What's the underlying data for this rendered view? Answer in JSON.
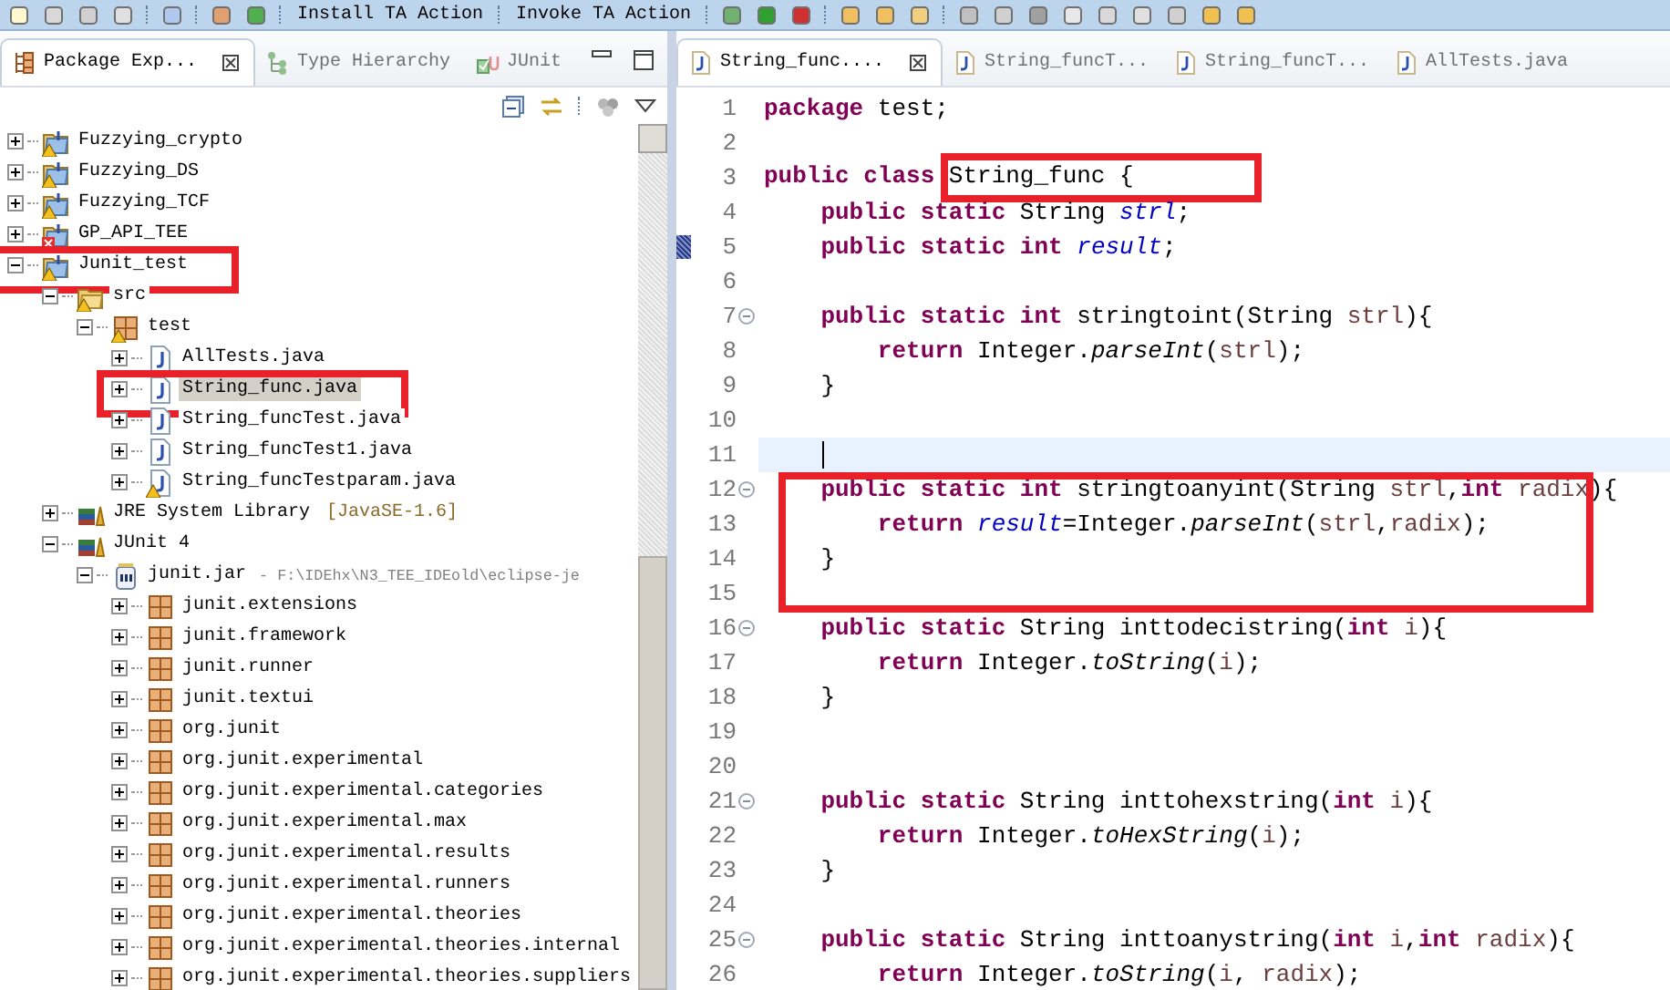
{
  "toolbar": {
    "actions": [
      "Install TA Action",
      "Invoke TA Action"
    ]
  },
  "explorer": {
    "tabs": [
      {
        "label": "Package Exp...",
        "kind": "packages",
        "selected": true,
        "closable": true
      },
      {
        "label": "Type Hierarchy",
        "kind": "hierarchy",
        "selected": false,
        "closable": false
      },
      {
        "label": "JUnit",
        "kind": "junit",
        "selected": false,
        "closable": false
      }
    ],
    "tree": [
      {
        "label": "Fuzzying_crypto",
        "kind": "project",
        "warning": true,
        "error": false,
        "expanded": false,
        "selected": false,
        "annotated": false
      },
      {
        "label": "Fuzzying_DS",
        "kind": "project",
        "warning": true,
        "error": false,
        "expanded": false,
        "selected": false,
        "annotated": false
      },
      {
        "label": "Fuzzying_TCF",
        "kind": "project",
        "warning": true,
        "error": false,
        "expanded": false,
        "selected": false,
        "annotated": false
      },
      {
        "label": "GP_API_TEE",
        "kind": "project",
        "warning": false,
        "error": true,
        "expanded": false,
        "selected": false,
        "annotated": false
      },
      {
        "label": "Junit_test",
        "kind": "project",
        "warning": true,
        "error": false,
        "expanded": true,
        "selected": false,
        "annotated": true,
        "children": [
          {
            "label": "src",
            "kind": "source-folder",
            "warning": true,
            "error": false,
            "expanded": true,
            "selected": false,
            "annotated": false,
            "children": [
              {
                "label": "test",
                "kind": "package",
                "warning": true,
                "error": false,
                "expanded": true,
                "selected": false,
                "annotated": false,
                "children": [
                  {
                    "label": "AllTests.java",
                    "kind": "java",
                    "warning": false,
                    "error": false,
                    "expanded": false,
                    "selected": false,
                    "annotated": false
                  },
                  {
                    "label": "String_func.java",
                    "kind": "java",
                    "warning": false,
                    "error": false,
                    "expanded": false,
                    "selected": true,
                    "annotated": true
                  },
                  {
                    "label": "String_funcTest.java",
                    "kind": "java",
                    "warning": false,
                    "error": false,
                    "expanded": false,
                    "selected": false,
                    "annotated": false
                  },
                  {
                    "label": "String_funcTest1.java",
                    "kind": "java",
                    "warning": false,
                    "error": false,
                    "expanded": false,
                    "selected": false,
                    "annotated": false
                  },
                  {
                    "label": "String_funcTestparam.java",
                    "kind": "java",
                    "warning": true,
                    "error": false,
                    "expanded": false,
                    "selected": false,
                    "annotated": false
                  }
                ]
              }
            ]
          },
          {
            "label": "JRE System Library",
            "detail": "[JavaSE-1.6]",
            "kind": "library",
            "warning": false,
            "error": false,
            "expanded": false,
            "selected": false,
            "annotated": false
          },
          {
            "label": "JUnit 4",
            "kind": "library",
            "warning": false,
            "error": false,
            "expanded": true,
            "selected": false,
            "annotated": false,
            "children": [
              {
                "label": "junit.jar",
                "detail": "- F:\\IDEhx\\N3_TEE_IDEold\\eclipse-je",
                "kind": "jar",
                "warning": false,
                "error": false,
                "expanded": true,
                "selected": false,
                "annotated": false,
                "children": [
                  {
                    "label": "junit.extensions",
                    "kind": "package",
                    "warning": false,
                    "error": false,
                    "expanded": false,
                    "selected": false,
                    "annotated": false
                  },
                  {
                    "label": "junit.framework",
                    "kind": "package",
                    "warning": false,
                    "error": false,
                    "expanded": false,
                    "selected": false,
                    "annotated": false
                  },
                  {
                    "label": "junit.runner",
                    "kind": "package",
                    "warning": false,
                    "error": false,
                    "expanded": false,
                    "selected": false,
                    "annotated": false
                  },
                  {
                    "label": "junit.textui",
                    "kind": "package",
                    "warning": false,
                    "error": false,
                    "expanded": false,
                    "selected": false,
                    "annotated": false
                  },
                  {
                    "label": "org.junit",
                    "kind": "package",
                    "warning": false,
                    "error": false,
                    "expanded": false,
                    "selected": false,
                    "annotated": false
                  },
                  {
                    "label": "org.junit.experimental",
                    "kind": "package",
                    "warning": false,
                    "error": false,
                    "expanded": false,
                    "selected": false,
                    "annotated": false
                  },
                  {
                    "label": "org.junit.experimental.categories",
                    "kind": "package",
                    "warning": false,
                    "error": false,
                    "expanded": false,
                    "selected": false,
                    "annotated": false
                  },
                  {
                    "label": "org.junit.experimental.max",
                    "kind": "package",
                    "warning": false,
                    "error": false,
                    "expanded": false,
                    "selected": false,
                    "annotated": false
                  },
                  {
                    "label": "org.junit.experimental.results",
                    "kind": "package",
                    "warning": false,
                    "error": false,
                    "expanded": false,
                    "selected": false,
                    "annotated": false
                  },
                  {
                    "label": "org.junit.experimental.runners",
                    "kind": "package",
                    "warning": false,
                    "error": false,
                    "expanded": false,
                    "selected": false,
                    "annotated": false
                  },
                  {
                    "label": "org.junit.experimental.theories",
                    "kind": "package",
                    "warning": false,
                    "error": false,
                    "expanded": false,
                    "selected": false,
                    "annotated": false
                  },
                  {
                    "label": "org.junit.experimental.theories.internal",
                    "kind": "package",
                    "warning": false,
                    "error": false,
                    "expanded": false,
                    "selected": false,
                    "annotated": false
                  },
                  {
                    "label": "org.junit.experimental.theories.suppliers",
                    "kind": "package",
                    "warning": false,
                    "error": false,
                    "expanded": false,
                    "selected": false,
                    "annotated": false
                  }
                ]
              }
            ]
          }
        ]
      }
    ]
  },
  "editor": {
    "tabs": [
      {
        "label": "String_func....",
        "selected": true,
        "closable": true
      },
      {
        "label": "String_funcT...",
        "selected": false,
        "closable": false
      },
      {
        "label": "String_funcT...",
        "selected": false,
        "closable": false
      },
      {
        "label": "AllTests.java",
        "selected": false,
        "closable": false
      }
    ],
    "lines": [
      {
        "number": "1",
        "current": false,
        "foldable": false,
        "marker": false,
        "boxed": false,
        "tokens": [
          {
            "kind": "keyword",
            "text": "package"
          },
          {
            "kind": "plain",
            "text": " test;"
          }
        ]
      },
      {
        "number": "2",
        "current": false,
        "foldable": false,
        "marker": false,
        "boxed": false
      },
      {
        "number": "3",
        "current": false,
        "foldable": false,
        "marker": false,
        "boxed": false,
        "tokens": [
          {
            "kind": "keyword",
            "text": "public class "
          },
          {
            "kind": "boxed",
            "text": "String_func {"
          }
        ]
      },
      {
        "number": "4",
        "current": false,
        "foldable": false,
        "marker": false,
        "boxed": false,
        "tokens": [
          {
            "kind": "keyword",
            "text": "    public static"
          },
          {
            "kind": "plain",
            "text": " String "
          },
          {
            "kind": "field",
            "text": "strl"
          },
          {
            "kind": "plain",
            "text": ";"
          }
        ]
      },
      {
        "number": "5",
        "current": false,
        "foldable": false,
        "marker": true,
        "boxed": false,
        "tokens": [
          {
            "kind": "keyword",
            "text": "    public static int "
          },
          {
            "kind": "field",
            "text": "result"
          },
          {
            "kind": "plain",
            "text": ";"
          }
        ]
      },
      {
        "number": "6",
        "current": false,
        "foldable": false,
        "marker": false,
        "boxed": false
      },
      {
        "number": "7",
        "current": false,
        "foldable": true,
        "marker": false,
        "boxed": false,
        "tokens": [
          {
            "kind": "keyword",
            "text": "    public static int"
          },
          {
            "kind": "plain",
            "text": " stringtoint(String "
          },
          {
            "kind": "param",
            "text": "strl"
          },
          {
            "kind": "plain",
            "text": "){"
          }
        ]
      },
      {
        "number": "8",
        "current": false,
        "foldable": false,
        "marker": false,
        "boxed": false,
        "tokens": [
          {
            "kind": "keyword",
            "text": "        return"
          },
          {
            "kind": "plain",
            "text": " Integer."
          },
          {
            "kind": "call",
            "text": "parseInt"
          },
          {
            "kind": "plain",
            "text": "("
          },
          {
            "kind": "param",
            "text": "strl"
          },
          {
            "kind": "plain",
            "text": ");"
          }
        ]
      },
      {
        "number": "9",
        "current": false,
        "foldable": false,
        "marker": false,
        "boxed": false,
        "tokens": [
          {
            "kind": "plain",
            "text": "    }"
          }
        ]
      },
      {
        "number": "10",
        "current": false,
        "foldable": false,
        "marker": false,
        "boxed": false
      },
      {
        "number": "11",
        "current": true,
        "foldable": false,
        "marker": false,
        "boxed": false
      },
      {
        "number": "12",
        "current": false,
        "foldable": true,
        "marker": false,
        "boxed": true,
        "tokens": [
          {
            "kind": "keyword",
            "text": "    public static int"
          },
          {
            "kind": "plain",
            "text": " stringtoanyint(String "
          },
          {
            "kind": "param",
            "text": "strl"
          },
          {
            "kind": "plain",
            "text": ","
          },
          {
            "kind": "keyword",
            "text": "int "
          },
          {
            "kind": "param",
            "text": "radix"
          },
          {
            "kind": "plain",
            "text": "){"
          }
        ]
      },
      {
        "number": "13",
        "current": false,
        "foldable": false,
        "marker": false,
        "boxed": true,
        "tokens": [
          {
            "kind": "keyword",
            "text": "        return "
          },
          {
            "kind": "field",
            "text": "result"
          },
          {
            "kind": "plain",
            "text": "=Integer."
          },
          {
            "kind": "call",
            "text": "parseInt"
          },
          {
            "kind": "plain",
            "text": "("
          },
          {
            "kind": "param",
            "text": "strl"
          },
          {
            "kind": "plain",
            "text": ","
          },
          {
            "kind": "param",
            "text": "radix"
          },
          {
            "kind": "plain",
            "text": ");"
          }
        ]
      },
      {
        "number": "14",
        "current": false,
        "foldable": false,
        "marker": false,
        "boxed": true,
        "tokens": [
          {
            "kind": "plain",
            "text": "    }"
          }
        ]
      },
      {
        "number": "15",
        "current": false,
        "foldable": false,
        "marker": false,
        "boxed": true
      },
      {
        "number": "16",
        "current": false,
        "foldable": true,
        "marker": false,
        "boxed": false,
        "tokens": [
          {
            "kind": "keyword",
            "text": "    public static"
          },
          {
            "kind": "plain",
            "text": " String inttodecistring("
          },
          {
            "kind": "keyword",
            "text": "int "
          },
          {
            "kind": "param",
            "text": "i"
          },
          {
            "kind": "plain",
            "text": "){"
          }
        ]
      },
      {
        "number": "17",
        "current": false,
        "foldable": false,
        "marker": false,
        "boxed": false,
        "tokens": [
          {
            "kind": "keyword",
            "text": "        return"
          },
          {
            "kind": "plain",
            "text": " Integer."
          },
          {
            "kind": "call",
            "text": "toString"
          },
          {
            "kind": "plain",
            "text": "("
          },
          {
            "kind": "param",
            "text": "i"
          },
          {
            "kind": "plain",
            "text": ");"
          }
        ]
      },
      {
        "number": "18",
        "current": false,
        "foldable": false,
        "marker": false,
        "boxed": false,
        "tokens": [
          {
            "kind": "plain",
            "text": "    }"
          }
        ]
      },
      {
        "number": "19",
        "current": false,
        "foldable": false,
        "marker": false,
        "boxed": false
      },
      {
        "number": "20",
        "current": false,
        "foldable": false,
        "marker": false,
        "boxed": false
      },
      {
        "number": "21",
        "current": false,
        "foldable": true,
        "marker": false,
        "boxed": false,
        "tokens": [
          {
            "kind": "keyword",
            "text": "    public static"
          },
          {
            "kind": "plain",
            "text": " String inttohexstring("
          },
          {
            "kind": "keyword",
            "text": "int "
          },
          {
            "kind": "param",
            "text": "i"
          },
          {
            "kind": "plain",
            "text": "){"
          }
        ]
      },
      {
        "number": "22",
        "current": false,
        "foldable": false,
        "marker": false,
        "boxed": false,
        "tokens": [
          {
            "kind": "keyword",
            "text": "        return"
          },
          {
            "kind": "plain",
            "text": " Integer."
          },
          {
            "kind": "call",
            "text": "toHexString"
          },
          {
            "kind": "plain",
            "text": "("
          },
          {
            "kind": "param",
            "text": "i"
          },
          {
            "kind": "plain",
            "text": ");"
          }
        ]
      },
      {
        "number": "23",
        "current": false,
        "foldable": false,
        "marker": false,
        "boxed": false,
        "tokens": [
          {
            "kind": "plain",
            "text": "    }"
          }
        ]
      },
      {
        "number": "24",
        "current": false,
        "foldable": false,
        "marker": false,
        "boxed": false
      },
      {
        "number": "25",
        "current": false,
        "foldable": true,
        "marker": false,
        "boxed": false,
        "tokens": [
          {
            "kind": "keyword",
            "text": "    public static"
          },
          {
            "kind": "plain",
            "text": " String inttoanystring("
          },
          {
            "kind": "keyword",
            "text": "int "
          },
          {
            "kind": "param",
            "text": "i"
          },
          {
            "kind": "plain",
            "text": ","
          },
          {
            "kind": "keyword",
            "text": "int "
          },
          {
            "kind": "param",
            "text": "radix"
          },
          {
            "kind": "plain",
            "text": "){"
          }
        ]
      },
      {
        "number": "26",
        "current": false,
        "foldable": false,
        "marker": false,
        "boxed": false,
        "tokens": [
          {
            "kind": "keyword",
            "text": "        return"
          },
          {
            "kind": "plain",
            "text": " Integer."
          },
          {
            "kind": "call",
            "text": "toString"
          },
          {
            "kind": "plain",
            "text": "("
          },
          {
            "kind": "param",
            "text": "i"
          },
          {
            "kind": "plain",
            "text": ", "
          },
          {
            "kind": "param",
            "text": "radix"
          },
          {
            "kind": "plain",
            "text": ");"
          }
        ]
      }
    ]
  }
}
